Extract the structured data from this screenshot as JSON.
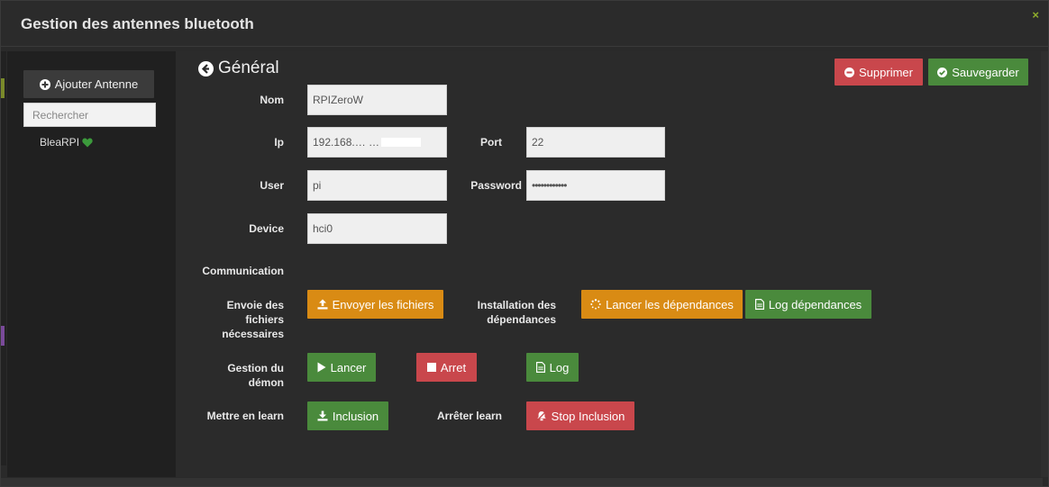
{
  "modal": {
    "title": "Gestion des antennes bluetooth",
    "close_label": "×"
  },
  "sidebar": {
    "add_button_label": "Ajouter Antenne",
    "search_placeholder": "Rechercher",
    "items": [
      {
        "label": "BleaRPI",
        "status_icon": "heart-icon",
        "status_color": "#3c9a3c"
      }
    ]
  },
  "section": {
    "title": "Général"
  },
  "actions": {
    "delete_label": "Supprimer",
    "save_label": "Sauvegarder"
  },
  "form": {
    "nom": {
      "label": "Nom",
      "value": "RPIZeroW"
    },
    "ip": {
      "label": "Ip",
      "value": "192.168.… …"
    },
    "port": {
      "label": "Port",
      "value": "22"
    },
    "user": {
      "label": "User",
      "value": "pi"
    },
    "password": {
      "label": "Password",
      "value": "••••••••••••"
    },
    "device": {
      "label": "Device",
      "value": "hci0"
    },
    "communication_label": "Communication",
    "envoie": {
      "label": "Envoie des fichiers nécessaires",
      "button": "Envoyer les fichiers"
    },
    "installation": {
      "label": "Installation des dépendances",
      "launch_button": "Lancer les dépendances",
      "log_button": "Log dépendances"
    },
    "demon": {
      "label": "Gestion du démon",
      "start_button": "Lancer",
      "stop_button": "Arret",
      "log_button": "Log"
    },
    "learn": {
      "label": "Mettre en learn",
      "inclusion_button": "Inclusion",
      "stop_label": "Arrêter learn",
      "stop_inclusion_button": "Stop Inclusion"
    }
  },
  "colors": {
    "green": "#4a8a3c",
    "red": "#c9474c",
    "orange": "#d98b14",
    "close": "#8fae2c"
  }
}
